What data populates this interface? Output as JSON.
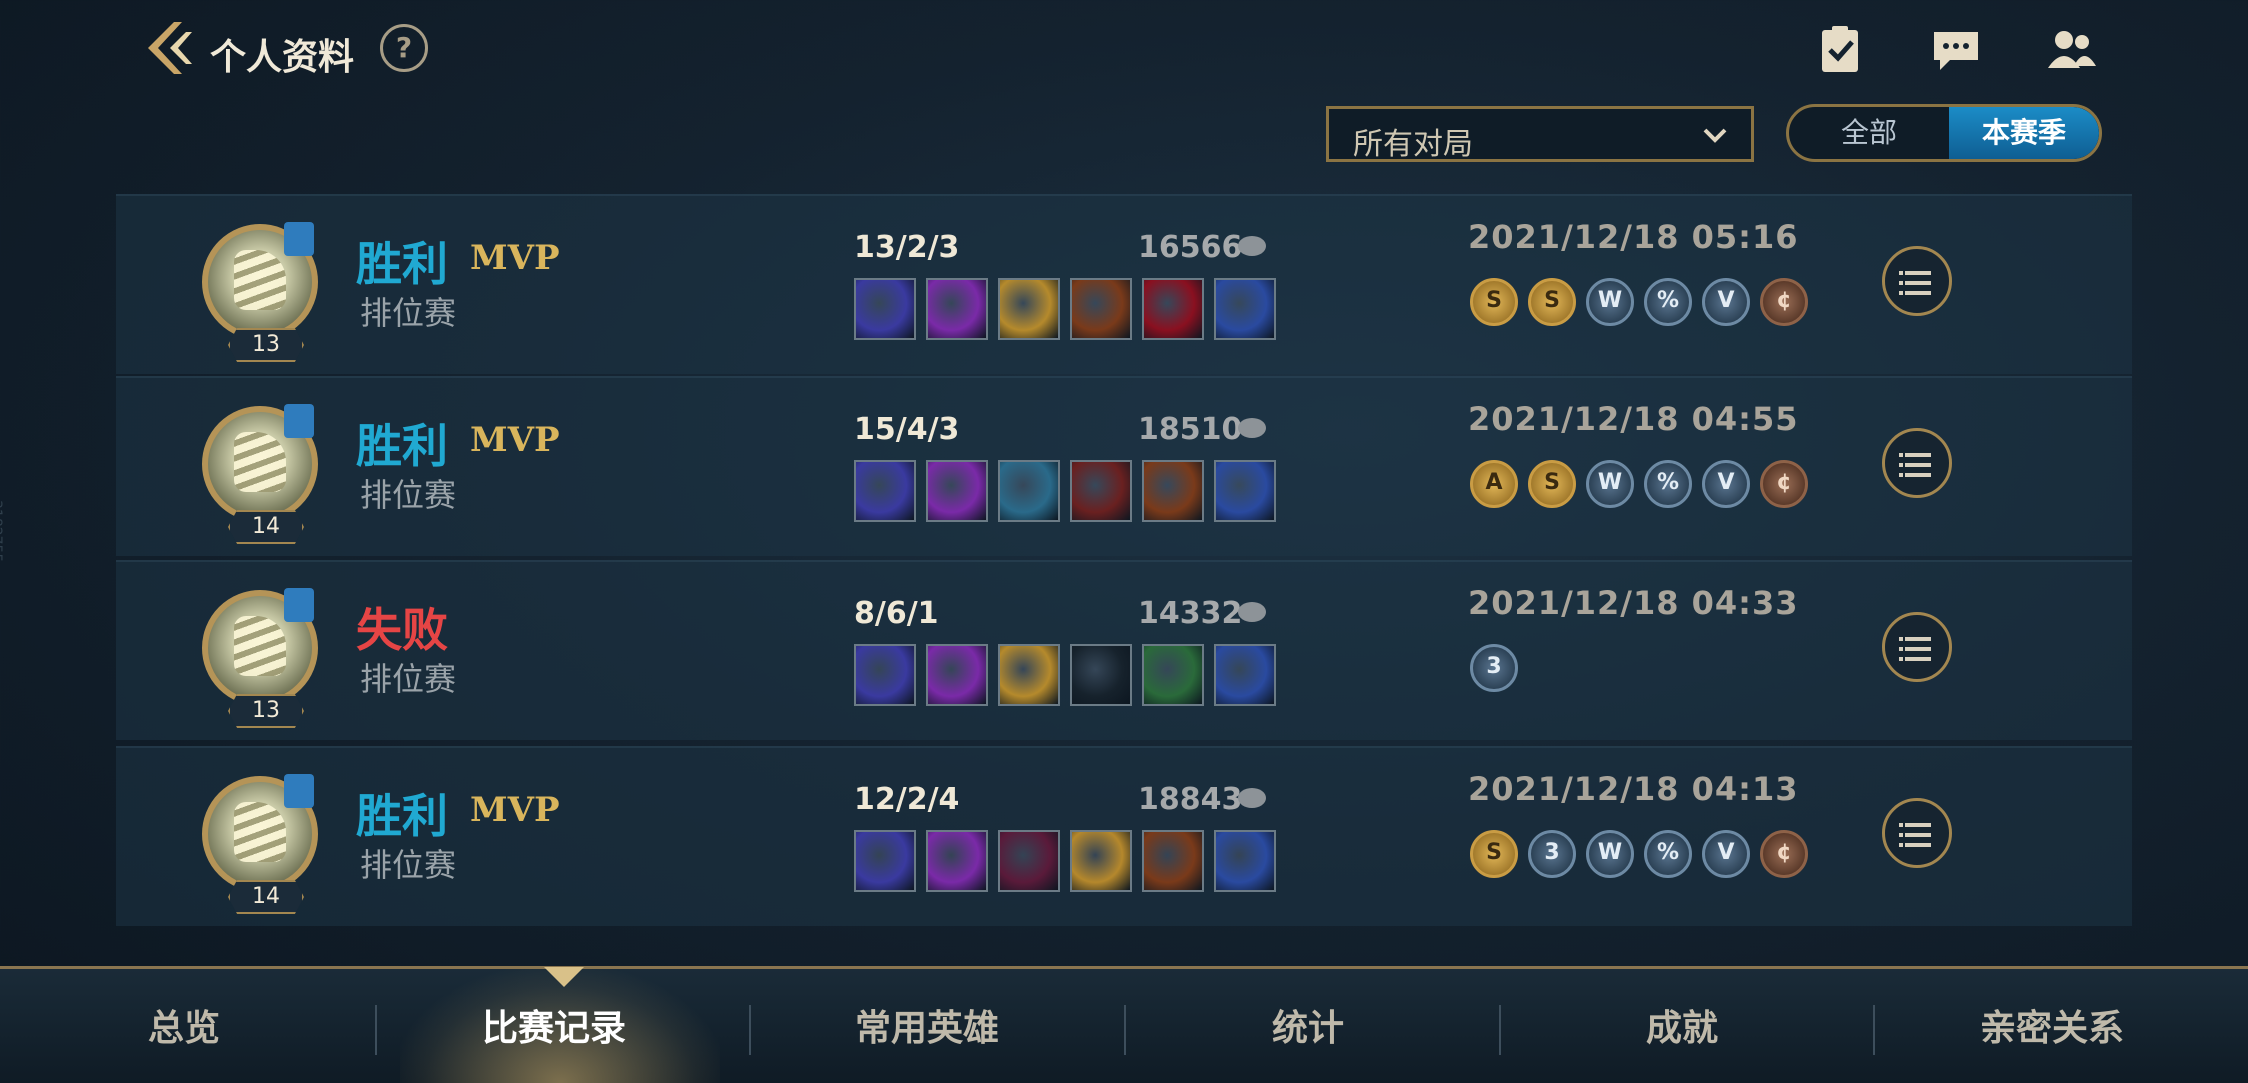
{
  "header": {
    "title": "个人资料",
    "help": "?"
  },
  "filter": {
    "selected": "所有对局"
  },
  "season_toggle": {
    "all": "全部",
    "current": "本赛季"
  },
  "side_text": "3182755",
  "matches": [
    {
      "result": "胜利",
      "mvp": "MVP",
      "mode": "排位赛",
      "level": "13",
      "kda": "13/2/3",
      "gold": "16566",
      "date": "2021/12/18 05:16",
      "badges": [
        "S",
        "S",
        "W",
        "%",
        "V",
        "¢"
      ]
    },
    {
      "result": "胜利",
      "mvp": "MVP",
      "mode": "排位赛",
      "level": "14",
      "kda": "15/4/3",
      "gold": "18510",
      "date": "2021/12/18 04:55",
      "badges": [
        "A",
        "S",
        "W",
        "%",
        "V",
        "¢"
      ]
    },
    {
      "result": "失败",
      "mvp": "",
      "mode": "排位赛",
      "level": "13",
      "kda": "8/6/1",
      "gold": "14332",
      "date": "2021/12/18 04:33",
      "badges": [
        "3"
      ]
    },
    {
      "result": "胜利",
      "mvp": "MVP",
      "mode": "排位赛",
      "level": "14",
      "kda": "12/2/4",
      "gold": "18843",
      "date": "2021/12/18 04:13",
      "badges": [
        "S",
        "3",
        "W",
        "%",
        "V",
        "¢"
      ]
    }
  ],
  "tabs": [
    "总览",
    "比赛记录",
    "常用英雄",
    "统计",
    "成就",
    "亲密关系"
  ],
  "active_tab": "比赛记录",
  "colors": {
    "win": "#20a9d2",
    "lose": "#e64545",
    "mvp": "#d9b55c",
    "accent_gold": "#8b7443",
    "toggle_active": "#1b8cc7"
  },
  "icons": {
    "back": "back-chevron-icon",
    "tasks": "clipboard-check-icon",
    "chat": "chat-bubble-icon",
    "friends": "friends-icon",
    "coin": "gold-coin-icon",
    "detail": "list-icon",
    "dropdown": "chevron-down-icon"
  }
}
